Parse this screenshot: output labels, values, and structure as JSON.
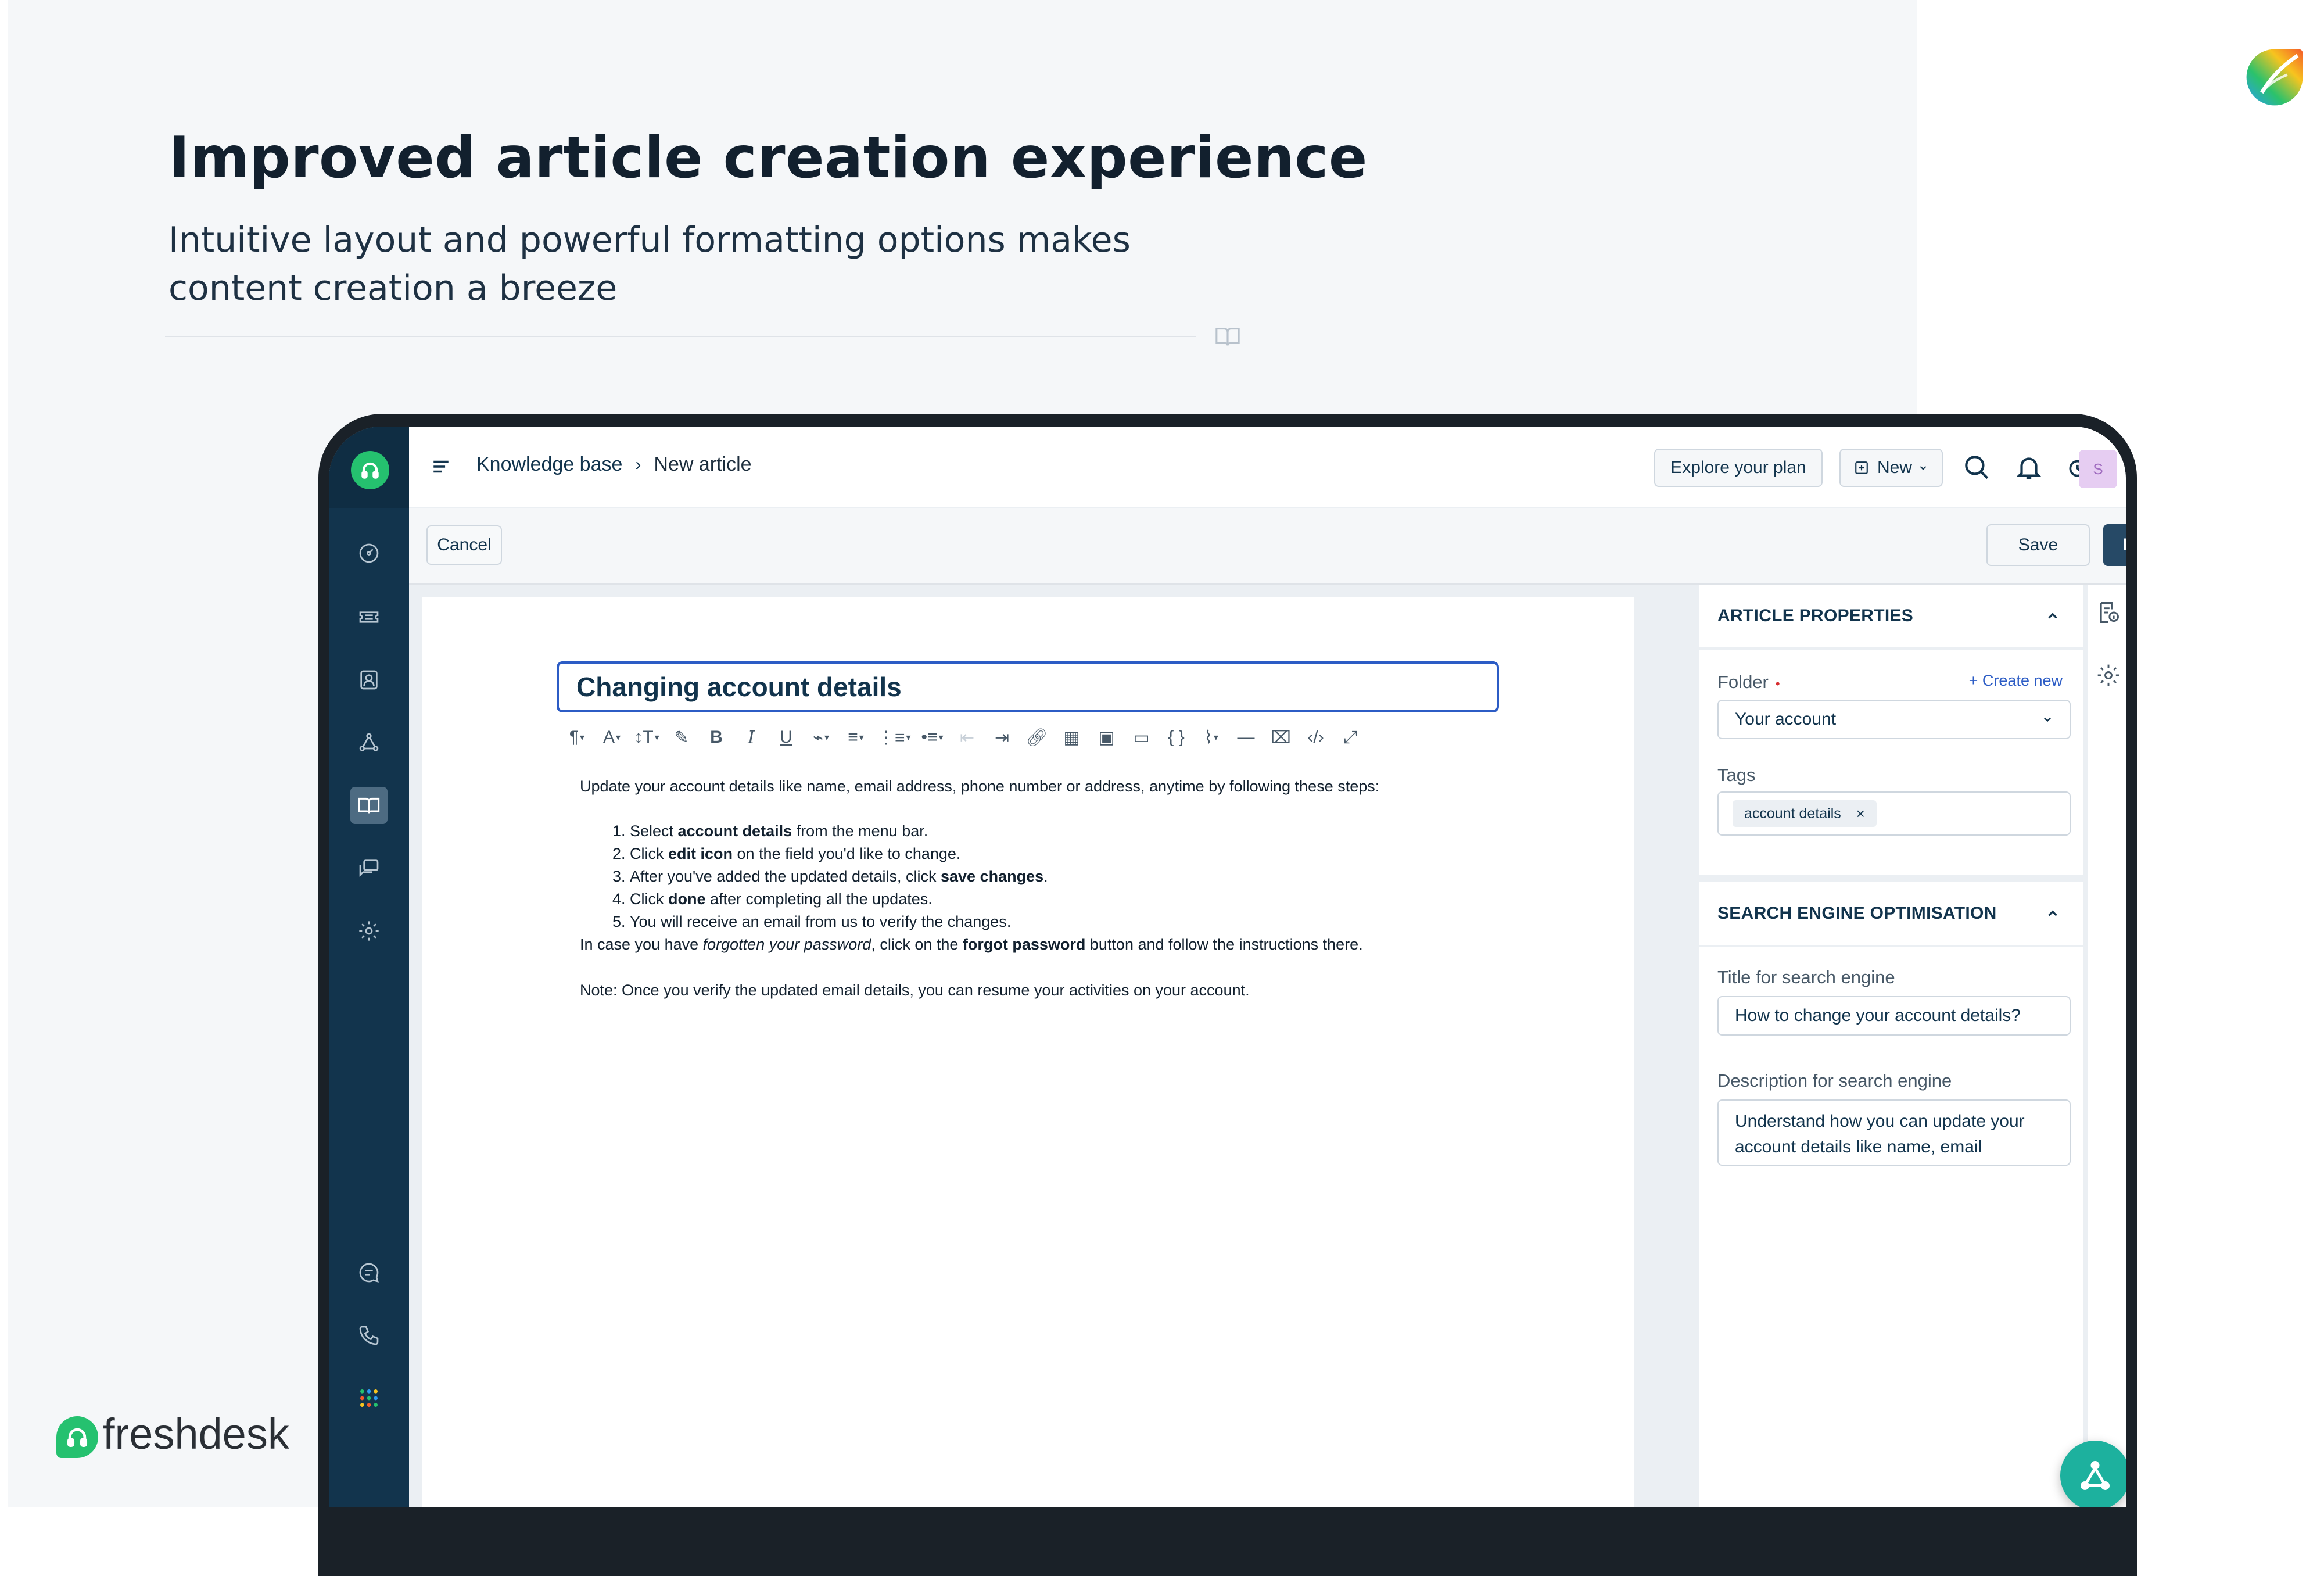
{
  "promo": {
    "headline": "Improved article creation experience",
    "subhead_line1": "Intuitive layout and powerful formatting options makes",
    "subhead_line2": "content creation a breeze",
    "brand": "freshdesk"
  },
  "topbar": {
    "breadcrumb_root": "Knowledge base",
    "breadcrumb_sep": "›",
    "breadcrumb_current": "New article",
    "explore_label": "Explore your plan",
    "new_label": "New",
    "avatar_initial": "S"
  },
  "actions": {
    "cancel_label": "Cancel",
    "save_label": "Save",
    "publish_label": "Publish"
  },
  "editor": {
    "title": "Changing account details",
    "intro": "Update your account details like name, email address, phone number or address, anytime by following these steps:",
    "steps": [
      {
        "pre": "Select ",
        "bold": "account details",
        "post": " from the menu bar."
      },
      {
        "pre": "Click ",
        "bold": "edit icon",
        "post": " on the field you'd like to change."
      },
      {
        "pre": "After you've added the updated details, click ",
        "bold": "save changes",
        "post": "."
      },
      {
        "pre": "Click ",
        "bold": "done",
        "post": " after completing all the updates."
      },
      {
        "pre": "You will receive an email from us to verify the changes.",
        "bold": "",
        "post": ""
      }
    ],
    "forgot_pre": "In case you have ",
    "forgot_italic": "forgotten your password",
    "forgot_mid": ", click on the ",
    "forgot_bold": "forgot password",
    "forgot_post": " button and follow the instructions there.",
    "note": "Note: Once you verify the updated email details, you can resume your activities on your account."
  },
  "properties": {
    "section_title": "ARTICLE PROPERTIES",
    "folder_label": "Folder",
    "required_mark": "•",
    "create_new": "+ Create new",
    "folder_value": "Your account",
    "tags_label": "Tags",
    "tags": [
      "account details"
    ],
    "tag_remove": "×"
  },
  "seo": {
    "section_title": "SEARCH ENGINE OPTIMISATION",
    "title_label": "Title for search engine",
    "title_value": "How to change your account details?",
    "desc_label": "Description for search engine",
    "desc_value": "Understand how you can update your account details like name, email"
  },
  "colors": {
    "sidebar": "#12344d",
    "brand_green": "#25c16f",
    "publish": "#264966",
    "focus_blue": "#2c5cc5",
    "fab": "#1db19e"
  },
  "icons": {
    "sidebar": [
      "dashboard-icon",
      "tickets-icon",
      "contacts-icon",
      "social-icon",
      "solutions-icon",
      "forums-icon",
      "settings-icon",
      "chat-icon",
      "phone-icon",
      "apps-grid-icon"
    ],
    "toolbar": [
      "paragraph-icon",
      "font-icon",
      "line-height-icon",
      "highlight-icon",
      "bold-icon",
      "italic-icon",
      "underline-icon",
      "color-icon",
      "align-icon",
      "ordered-list-icon",
      "unordered-list-icon",
      "outdent-icon",
      "indent-icon",
      "link-icon",
      "table-icon",
      "image-icon",
      "video-icon",
      "code-block-icon",
      "attachment-icon",
      "horizontal-rule-icon",
      "clear-format-icon",
      "source-code-icon",
      "fullscreen-icon"
    ]
  }
}
